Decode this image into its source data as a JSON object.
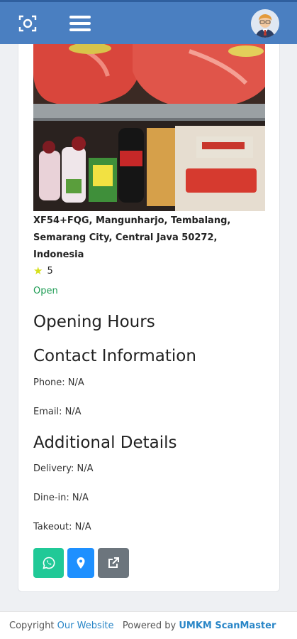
{
  "navbar": {
    "color": "#4a7fc1",
    "scan_icon": "scan-icon",
    "menu_icon": "hamburger-menu-icon",
    "avatar_icon": "user-avatar"
  },
  "listing": {
    "photo": "store-shelf-photo",
    "address": "XF54+FQG, Mangunharjo, Tembalang, Semarang City, Central Java 50272, Indonesia",
    "rating": "5",
    "status": "Open"
  },
  "sections": {
    "opening_hours": "Opening Hours",
    "contact_information": "Contact Information",
    "additional_details": "Additional Details"
  },
  "contact": {
    "phone": "Phone: N/A",
    "email": "Email: N/A"
  },
  "details": {
    "delivery": "Delivery: N/A",
    "dine_in": "Dine-in: N/A",
    "takeout": "Takeout: N/A"
  },
  "actions": {
    "whatsapp_icon": "whatsapp-icon",
    "map_icon": "map-marker-icon",
    "external_icon": "external-link-icon",
    "colors": {
      "whatsapp": "#20c997",
      "map": "#1e90ff",
      "external": "#6c757d"
    }
  },
  "footer": {
    "copyright": "Copyright",
    "website_link": "Our Website",
    "powered_by": "Powered by",
    "brand": "UMKM ScanMaster"
  }
}
